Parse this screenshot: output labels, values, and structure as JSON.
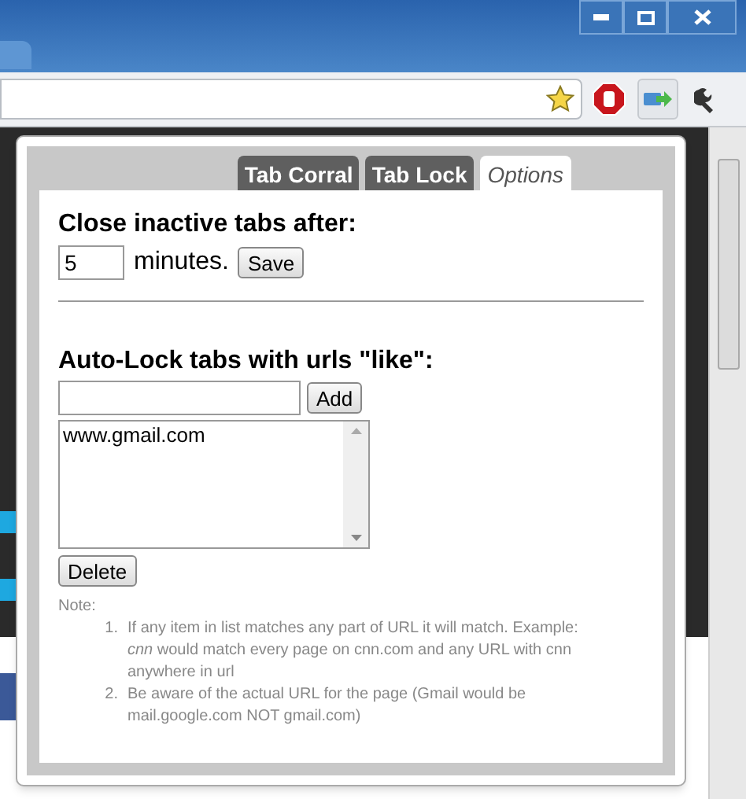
{
  "window": {
    "controls": [
      {
        "kind": "minimize"
      },
      {
        "kind": "maximize"
      },
      {
        "kind": "close"
      }
    ]
  },
  "popup": {
    "tabs": [
      {
        "label": "Tab Corral",
        "selected": false
      },
      {
        "label": "Tab Lock",
        "selected": false
      },
      {
        "label": "Options",
        "selected": true
      }
    ],
    "close_section": {
      "heading": "Close inactive tabs after:",
      "minutes_value": "5",
      "unit": "minutes.",
      "save_button": "Save"
    },
    "lock_section": {
      "heading": "Auto-Lock tabs with urls \"like\":",
      "add_button": "Add",
      "urls": [
        "www.gmail.com"
      ],
      "delete_button": "Delete"
    },
    "note": {
      "label": "Note:",
      "items": [
        {
          "number": "1.",
          "text": "If any item in list matches any part of URL it will match. Example: *cnn* would match every page on cnn.com and any URL with cnn anywhere in url"
        },
        {
          "number": "2.",
          "text": "Be aware of the actual URL for the page (Gmail would be mail.google.com NOT gmail.com)"
        }
      ]
    }
  }
}
